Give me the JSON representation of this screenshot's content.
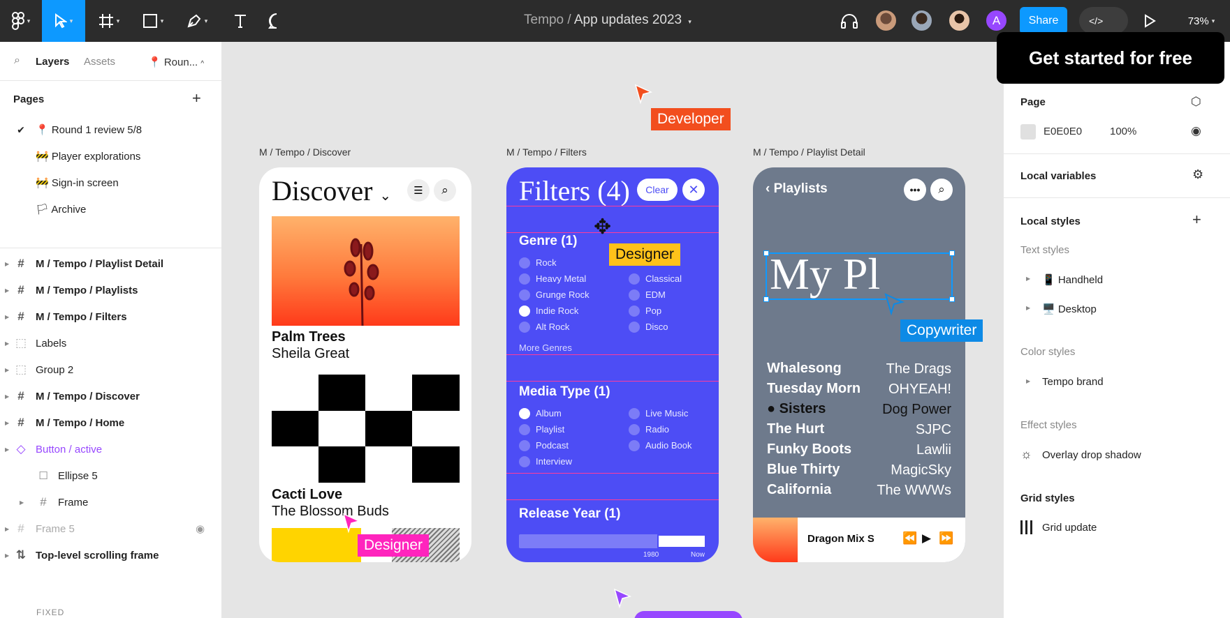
{
  "toolbar": {
    "file_project": "Tempo",
    "file_sep": "/",
    "file_name": "App updates 2023",
    "share_label": "Share",
    "zoom": "73%",
    "avatar_letter": "A"
  },
  "left_panel": {
    "tabs": [
      "Layers",
      "Assets"
    ],
    "page_chip": "📍 Roun...",
    "pages_heading": "Pages",
    "pages": [
      "📍 Round 1 review 5/8",
      "🚧 Player explorations",
      "🚧 Sign-in screen",
      "🏳 Archive"
    ],
    "layers": [
      {
        "name": "M / Tempo / Playlist Detail"
      },
      {
        "name": "M / Tempo / Playlists"
      },
      {
        "name": "M / Tempo / Filters"
      },
      {
        "name": "Labels"
      },
      {
        "name": "Group 2"
      },
      {
        "name": "M / Tempo / Discover"
      },
      {
        "name": "M / Tempo / Home"
      },
      {
        "name": "Button / active"
      },
      {
        "name": "Ellipse 5"
      },
      {
        "name": "Frame"
      },
      {
        "name": "Frame 5"
      },
      {
        "name": "Top-level scrolling frame"
      }
    ],
    "fixed_label": "FIXED"
  },
  "canvas": {
    "frame_labels": [
      "M / Tempo / Discover",
      "M / Tempo / Filters",
      "M / Tempo / Playlist Detail"
    ],
    "cursors": [
      "Developer",
      "Designer",
      "Copywriter",
      "Designer"
    ],
    "discover": {
      "title": "Discover",
      "card1_title": "Palm Trees",
      "card1_artist": "Sheila Great",
      "card2_title": "Cacti Love",
      "card2_artist": "The Blossom Buds"
    },
    "filters": {
      "title": "Filters (4)",
      "clear": "Clear",
      "genre_heading": "Genre (1)",
      "genres_left": [
        "Rock",
        "Heavy Metal",
        "Grunge Rock",
        "Indie Rock",
        "Alt Rock"
      ],
      "genres_right": [
        "Classical",
        "EDM",
        "Pop",
        "Disco"
      ],
      "more_genres": "More Genres",
      "media_heading": "Media Type (1)",
      "media_left": [
        "Album",
        "Playlist",
        "Podcast",
        "Interview"
      ],
      "media_right": [
        "Live Music",
        "Radio",
        "Audio Book"
      ],
      "year_heading": "Release Year (1)",
      "year_min": "1980",
      "year_max": "Now"
    },
    "playlist": {
      "back_label": "Playlists",
      "title_partial": "My Pl",
      "rows": [
        {
          "song": "Whalesong",
          "artist": "The Drags"
        },
        {
          "song": "Tuesday Morn",
          "artist": "OHYEAH!"
        },
        {
          "song": "Sisters",
          "artist": "Dog Power"
        },
        {
          "song": "The Hurt",
          "artist": "SJPC"
        },
        {
          "song": "Funky Boots",
          "artist": "Lawlii"
        },
        {
          "song": "Blue Thirty",
          "artist": "MagicSky"
        },
        {
          "song": "California",
          "artist": "The WWWs"
        }
      ],
      "now_playing": "Dragon Mix Sist"
    }
  },
  "right_panel": {
    "cta": "Get started for free",
    "page_heading": "Page",
    "page_color": "E0E0E0",
    "page_opacity": "100%",
    "local_variables": "Local variables",
    "local_styles": "Local styles",
    "text_styles_heading": "Text styles",
    "text_styles": [
      "📱 Handheld",
      "🖥️ Desktop"
    ],
    "color_styles_heading": "Color styles",
    "color_styles": [
      "Tempo brand"
    ],
    "effect_styles_heading": "Effect styles",
    "effect_styles": [
      "Overlay drop shadow"
    ],
    "grid_styles_heading": "Grid styles",
    "grid_styles": [
      "Grid update"
    ]
  },
  "colors": {
    "toolbar_bg": "#2c2c2c",
    "accent_blue": "#0d99ff",
    "filters_bg": "#4d4df5",
    "playlist_bg": "#6e7a8c",
    "developer_tag": "#f24e1e",
    "designer_tag_yellow": "#ffc21a",
    "designer_tag_pink": "#ff24bd",
    "copywriter_tag": "#0d8ae6",
    "component_purple": "#9747ff"
  }
}
